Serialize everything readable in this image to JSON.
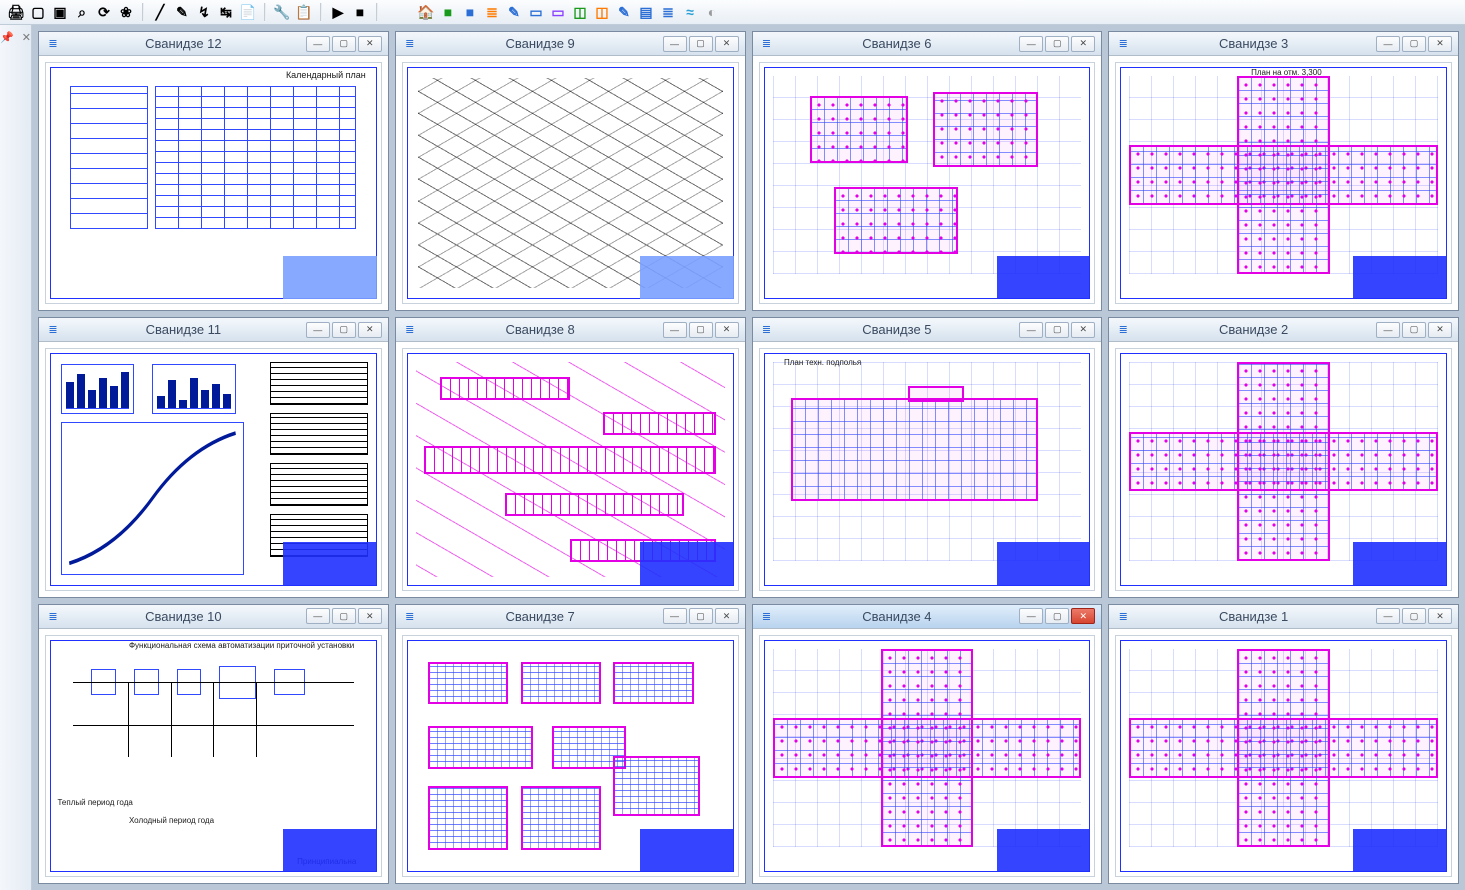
{
  "toolbar1": {
    "groups": [
      {
        "items": [
          {
            "name": "tool-print",
            "glyph": "🖨"
          },
          {
            "name": "tool-sheet",
            "glyph": "▢"
          },
          {
            "name": "tool-open",
            "glyph": "▣"
          },
          {
            "name": "tool-zoom-ext",
            "glyph": "⌕"
          },
          {
            "name": "tool-refresh",
            "glyph": "⟳"
          },
          {
            "name": "tool-layer",
            "glyph": "❀"
          }
        ]
      },
      {
        "items": [
          {
            "name": "tool-line",
            "glyph": "╱"
          },
          {
            "name": "tool-dim",
            "glyph": "✎"
          },
          {
            "name": "tool-hatch",
            "glyph": "↯"
          },
          {
            "name": "tool-offset",
            "glyph": "↹"
          },
          {
            "name": "tool-copy",
            "glyph": "📄"
          }
        ]
      },
      {
        "items": [
          {
            "name": "tool-wrench",
            "glyph": "🔧"
          },
          {
            "name": "tool-props",
            "glyph": "📋"
          }
        ]
      },
      {
        "items": [
          {
            "name": "tool-play",
            "glyph": "▶"
          },
          {
            "name": "tool-stop",
            "glyph": "■"
          }
        ]
      }
    ]
  },
  "toolbar2": {
    "groups": [
      {
        "items": [
          {
            "name": "palette-home",
            "glyph": "🏠",
            "color": "#d07000"
          },
          {
            "name": "palette-green",
            "glyph": "■",
            "color": "#1a9a1a"
          },
          {
            "name": "palette-blue",
            "glyph": "■",
            "color": "#2a6ed6"
          },
          {
            "name": "palette-stairs",
            "glyph": "≣",
            "color": "#ff7a00"
          },
          {
            "name": "palette-style",
            "glyph": "✎",
            "color": "#2a6ed6"
          },
          {
            "name": "palette-box1",
            "glyph": "▭",
            "color": "#2a6ed6"
          },
          {
            "name": "palette-box2",
            "glyph": "▭",
            "color": "#8a40ff"
          },
          {
            "name": "palette-select",
            "glyph": "◫",
            "color": "#1a9a1a"
          },
          {
            "name": "palette-area",
            "glyph": "◫",
            "color": "#ff7a00"
          },
          {
            "name": "palette-edit",
            "glyph": "✎",
            "color": "#2a6ed6"
          },
          {
            "name": "palette-sheet",
            "glyph": "▤",
            "color": "#2a6ed6"
          },
          {
            "name": "palette-layers",
            "glyph": "≣",
            "color": "#2a6ed6"
          },
          {
            "name": "palette-wave",
            "glyph": "≈",
            "color": "#2aa0d6"
          },
          {
            "name": "palette-globe",
            "glyph": "◐",
            "color": "#9a9a9a"
          }
        ]
      }
    ]
  },
  "side_panel": {
    "pin": "📌",
    "close": "✕"
  },
  "windows": [
    {
      "id": 12,
      "title": "Сванидзе 12",
      "kind": "schedule",
      "caption": "Календарный план"
    },
    {
      "id": 9,
      "title": "Сванидзе 9",
      "kind": "isometric"
    },
    {
      "id": 6,
      "title": "Сванидзе 6",
      "kind": "plan-small"
    },
    {
      "id": 3,
      "title": "Сванидзе 3",
      "kind": "plan-cross",
      "caption": "План на отм. 3,300"
    },
    {
      "id": 11,
      "title": "Сванидзе 11",
      "kind": "charts"
    },
    {
      "id": 8,
      "title": "Сванидзе 8",
      "kind": "duct"
    },
    {
      "id": 5,
      "title": "Сванидзе 5",
      "kind": "plan-basement",
      "caption": "План техн. подполья"
    },
    {
      "id": 2,
      "title": "Сванидзе 2",
      "kind": "plan-cross"
    },
    {
      "id": 10,
      "title": "Сванидзе 10",
      "kind": "schematic",
      "caption": "Функциональная схема автоматизации приточной установки",
      "sub1": "Теплый период года",
      "sub2": "Холодный период года",
      "sub3": "Принципиальна"
    },
    {
      "id": 7,
      "title": "Сванидзе 7",
      "kind": "sections"
    },
    {
      "id": 4,
      "title": "Сванидзе 4",
      "kind": "plan-cross",
      "active": true
    },
    {
      "id": 1,
      "title": "Сванидзе 1",
      "kind": "plan-cross"
    }
  ],
  "win_buttons": {
    "minimize": "—",
    "maximize": "▢",
    "close": "✕"
  },
  "win11": {
    "bars_a": [
      26,
      34,
      18,
      30,
      22,
      36
    ],
    "bars_b": [
      12,
      28,
      8,
      30,
      18,
      24,
      14
    ]
  }
}
